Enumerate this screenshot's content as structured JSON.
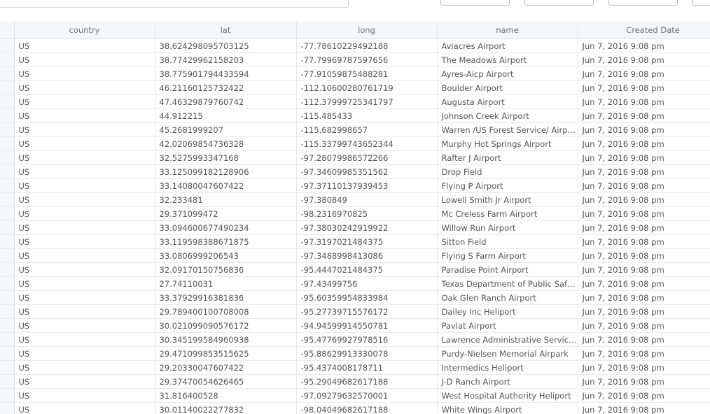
{
  "columns": [
    "",
    "country",
    "lat",
    "long",
    "name",
    "Created Date"
  ],
  "rows": [
    [
      "US",
      "38.624298095703125",
      "-77.78610229492188",
      "Aviacres Airport",
      "Jun 7, 2016 9:08 pm"
    ],
    [
      "US",
      "38.77429962158203",
      "-77.79969787597656",
      "The Meadows Airport",
      "Jun 7, 2016 9:08 pm"
    ],
    [
      "US",
      "38.775901794433594",
      "-77.91059875488281",
      "Ayres-Aicp Airport",
      "Jun 7, 2016 9:08 pm"
    ],
    [
      "US",
      "46.21160125732422",
      "-112.10600280761719",
      "Boulder Airport",
      "Jun 7, 2016 9:08 pm"
    ],
    [
      "US",
      "47.46329879760742",
      "-112.37999725341797",
      "Augusta Airport",
      "Jun 7, 2016 9:08 pm"
    ],
    [
      "US",
      "44.912215",
      "-115.485433",
      "Johnson Creek Airport",
      "Jun 7, 2016 9:08 pm"
    ],
    [
      "US",
      "45.2681999207",
      "-115.682998657",
      "Warren /US Forest Service/ Airport",
      "Jun 7, 2016 9:08 pm"
    ],
    [
      "US",
      "42.02069854736328",
      "-115.33799743652344",
      "Murphy Hot Springs Airport",
      "Jun 7, 2016 9:08 pm"
    ],
    [
      "US",
      "32.5275993347168",
      "-97.28079986572266",
      "Rafter J Airport",
      "Jun 7, 2016 9:08 pm"
    ],
    [
      "US",
      "33.125099182128906",
      "-97.34609985351562",
      "Drop Field",
      "Jun 7, 2016 9:08 pm"
    ],
    [
      "US",
      "33.14080047607422",
      "-97.37110137939453",
      "Flying P Airport",
      "Jun 7, 2016 9:08 pm"
    ],
    [
      "US",
      "32.233481",
      "-97.380849",
      "Lowell Smith Jr Airport",
      "Jun 7, 2016 9:08 pm"
    ],
    [
      "US",
      "29.371099472",
      "-98.2316970825",
      "Mc Creless Farm Airport",
      "Jun 7, 2016 9:08 pm"
    ],
    [
      "US",
      "33.094600677490234",
      "-97.38030242919922",
      "Willow Run Airport",
      "Jun 7, 2016 9:08 pm"
    ],
    [
      "US",
      "33.119598388671875",
      "-97.3197021484375",
      "Sitton Field",
      "Jun 7, 2016 9:08 pm"
    ],
    [
      "US",
      "33.0806999206543",
      "-97.3488998413086",
      "Flying S Farm Airport",
      "Jun 7, 2016 9:08 pm"
    ],
    [
      "US",
      "32.09170150756836",
      "-95.4447021484375",
      "Paradise Point Airport",
      "Jun 7, 2016 9:08 pm"
    ],
    [
      "US",
      "27.74110031",
      "-97.43499756",
      "Texas Department of Public Safety Helistop",
      "Jun 7, 2016 9:08 pm"
    ],
    [
      "US",
      "33.37929916381836",
      "-95.60359954833984",
      "Oak Glen Ranch Airport",
      "Jun 7, 2016 9:08 pm"
    ],
    [
      "US",
      "29.789400100708008",
      "-95.27739715576172",
      "Dailey Inc Heliport",
      "Jun 7, 2016 9:08 pm"
    ],
    [
      "US",
      "30.021099090576172",
      "-94.94599914550781",
      "Pavlat Airport",
      "Jun 7, 2016 9:08 pm"
    ],
    [
      "US",
      "30.345199584960938",
      "-95.47769927978516",
      "Lawrence Administrative Services Heliport",
      "Jun 7, 2016 9:08 pm"
    ],
    [
      "US",
      "29.471099853515625",
      "-95.88629913330078",
      "Purdy-Nielsen Memorial Airpark",
      "Jun 7, 2016 9:08 pm"
    ],
    [
      "US",
      "29.20330047607422",
      "-95.4374008178711",
      "Intermedics Heliport",
      "Jun 7, 2016 9:08 pm"
    ],
    [
      "US",
      "29.37470054626465",
      "-95.29049682617188",
      "J-D Ranch Airport",
      "Jun 7, 2016 9:08 pm"
    ],
    [
      "US",
      "31.816400528",
      "-97.09279632570001",
      "West Hospital Authority Heliport",
      "Jun 7, 2016 9:08 pm"
    ],
    [
      "US",
      "30.01140022277832",
      "-98.04049682617188",
      "White Wings Airport",
      "Jun 7, 2016 9:08 pm"
    ]
  ]
}
